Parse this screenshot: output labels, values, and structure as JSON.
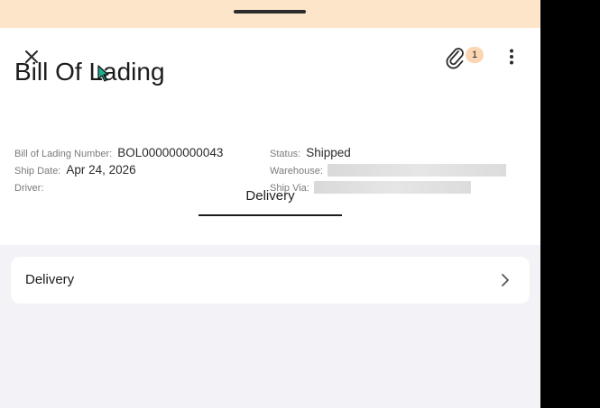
{
  "header": {
    "title": "Bill Of Lading",
    "attachment_count": "1"
  },
  "details": {
    "bol_number_label": "Bill of Lading Number:",
    "bol_number_value": "BOL000000000043",
    "ship_date_label": "Ship Date:",
    "ship_date_value": "Apr 24, 2026",
    "driver_label": "Driver:",
    "driver_value": "",
    "status_label": "Status:",
    "status_value": "Shipped",
    "warehouse_label": "Warehouse:",
    "ship_via_label": "Ship Via:"
  },
  "tabs": [
    {
      "label": "Delivery",
      "selected": true
    }
  ],
  "sections": [
    {
      "label": "Delivery"
    }
  ],
  "icons": {
    "close": "close-icon",
    "attachment": "paperclip-icon",
    "more": "more-vertical-icon",
    "chevron": "chevron-right-icon"
  },
  "colors": {
    "top_bar": "#fde5c9",
    "badge": "#fbd6b3",
    "background": "#f2f2f7",
    "cursor": "#1fae8f"
  }
}
